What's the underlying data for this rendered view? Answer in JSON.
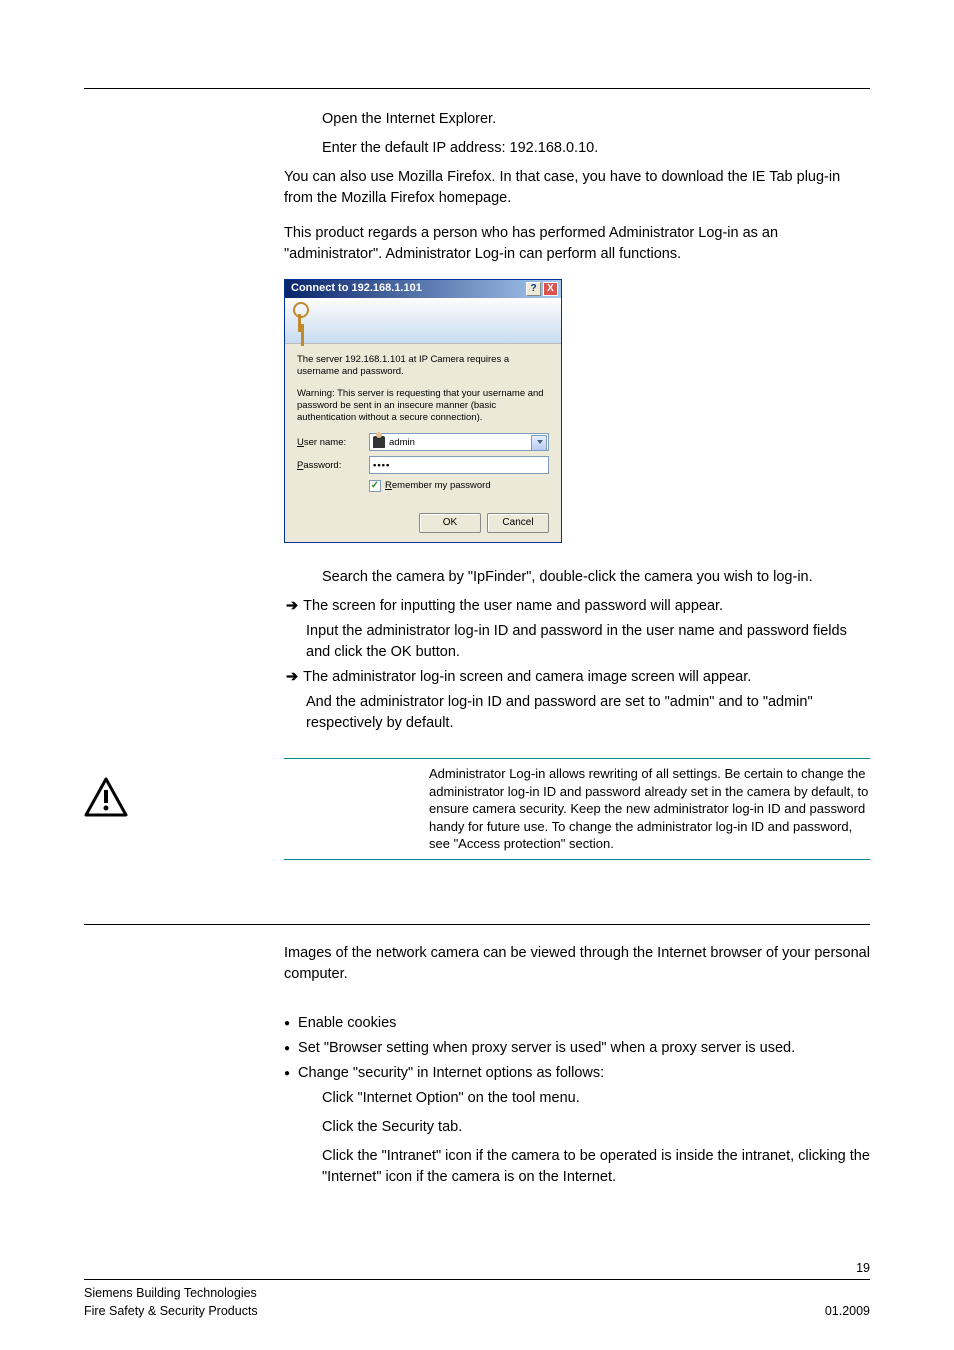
{
  "sec1": {
    "step1": "Open the Internet Explorer.",
    "step2": "Enter the default IP address: 192.168.0.10.",
    "p1": "You can also use Mozilla Firefox. In that case, you have to download the IE Tab plug-in from the Mozilla Firefox homepage.",
    "p2": "This product regards a person who has performed Administrator Log-in as an \"administrator\". Administrator Log-in can perform all functions."
  },
  "dialog": {
    "title": "Connect to 192.168.1.101",
    "msg1": "The server 192.168.1.101 at IP Camera requires a username and password.",
    "msg2": "Warning: This server is requesting that your username and password be sent in an insecure manner (basic authentication without a secure connection).",
    "user_label_u": "U",
    "user_label_rest": "ser name:",
    "pass_label_u": "P",
    "pass_label_rest": "assword:",
    "user_value": "admin",
    "pass_value": "••••",
    "remember_u": "R",
    "remember_rest": "emember my password",
    "ok": "OK",
    "cancel": "Cancel"
  },
  "sec2": {
    "s1": "Search the camera by \"IpFinder\", double-click the camera you wish to log-in.",
    "a1": "The screen for inputting the user name and password will appear.",
    "s2": "Input the administrator log-in ID and password in the user name and password fields and click the OK button.",
    "a2a": "The administrator log-in screen and camera image screen will appear.",
    "a2b": "And the administrator log-in ID and password are set to \"admin\" and to \"admin\" respectively by default."
  },
  "warn": "Administrator Log-in allows rewriting of all settings. Be certain to change the administrator log-in ID and password already set in the camera by default, to ensure camera security. Keep the new administrator log-in ID and password handy for future use. To change the administrator log-in ID and password, see \"Access protection\" section.",
  "sec3": {
    "intro": "Images of the network camera can be viewed through the Internet browser of your personal computer.",
    "b1": "Enable cookies",
    "b2": "Set \"Browser setting when proxy server is used\" when a proxy server is used.",
    "b3": "Change \"security\" in Internet options as follows:",
    "c1": "Click \"Internet Option\" on the tool menu.",
    "c2": "Click the Security tab.",
    "c3": "Click the \"Intranet\" icon if the camera to be operated is inside the intranet, clicking the \"Internet\" icon if the camera is on the Internet."
  },
  "footer": {
    "page": "19",
    "left1": "Siemens Building Technologies",
    "left2": "Fire Safety & Security Products",
    "right": "01.2009"
  }
}
